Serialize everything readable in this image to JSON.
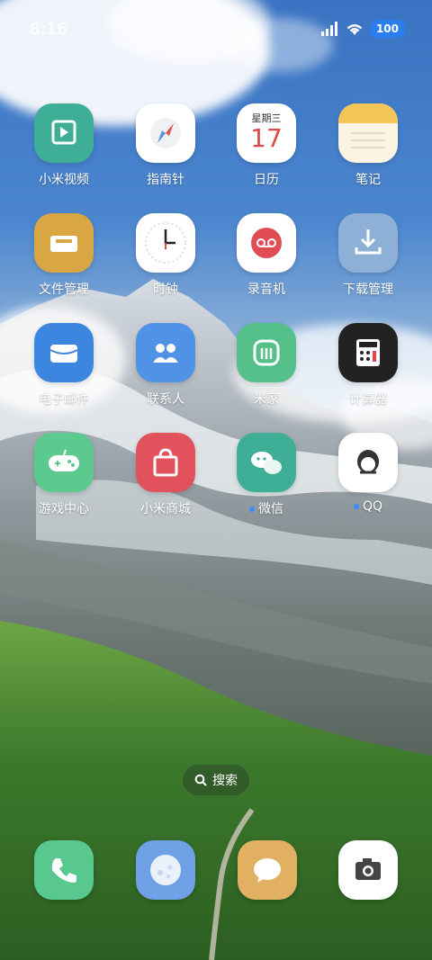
{
  "status_bar": {
    "time": "8:16",
    "battery": "100"
  },
  "apps": [
    {
      "label": "小米视频"
    },
    {
      "label": "指南针"
    },
    {
      "label": "日历",
      "icon_weekday": "星期三",
      "icon_day": "17"
    },
    {
      "label": "笔记"
    },
    {
      "label": "文件管理"
    },
    {
      "label": "时钟"
    },
    {
      "label": "录音机"
    },
    {
      "label": "下载管理"
    },
    {
      "label": "电子邮件"
    },
    {
      "label": "联系人"
    },
    {
      "label": "米家"
    },
    {
      "label": "计算器"
    },
    {
      "label": "游戏中心"
    },
    {
      "label": "小米商城"
    },
    {
      "label": "微信"
    },
    {
      "label": "QQ"
    }
  ],
  "search": {
    "label": "搜索"
  },
  "dock": [
    "phone-icon",
    "browser-icon",
    "messages-icon",
    "camera-icon"
  ],
  "colors": {
    "video": "#3fae96",
    "files": "#d9a644",
    "mail": "#3d86e0",
    "contacts": "#4f92e6",
    "mihome": "#56c08b",
    "calculator": "#222222",
    "game": "#5cc98e",
    "store": "#e1525c",
    "wechat": "#3fae96",
    "phone": "#58c88f",
    "browser": "#6fa1e6",
    "messages": "#e2b063",
    "notification_dot": "#3a8bff",
    "battery": "#2b7df0"
  }
}
